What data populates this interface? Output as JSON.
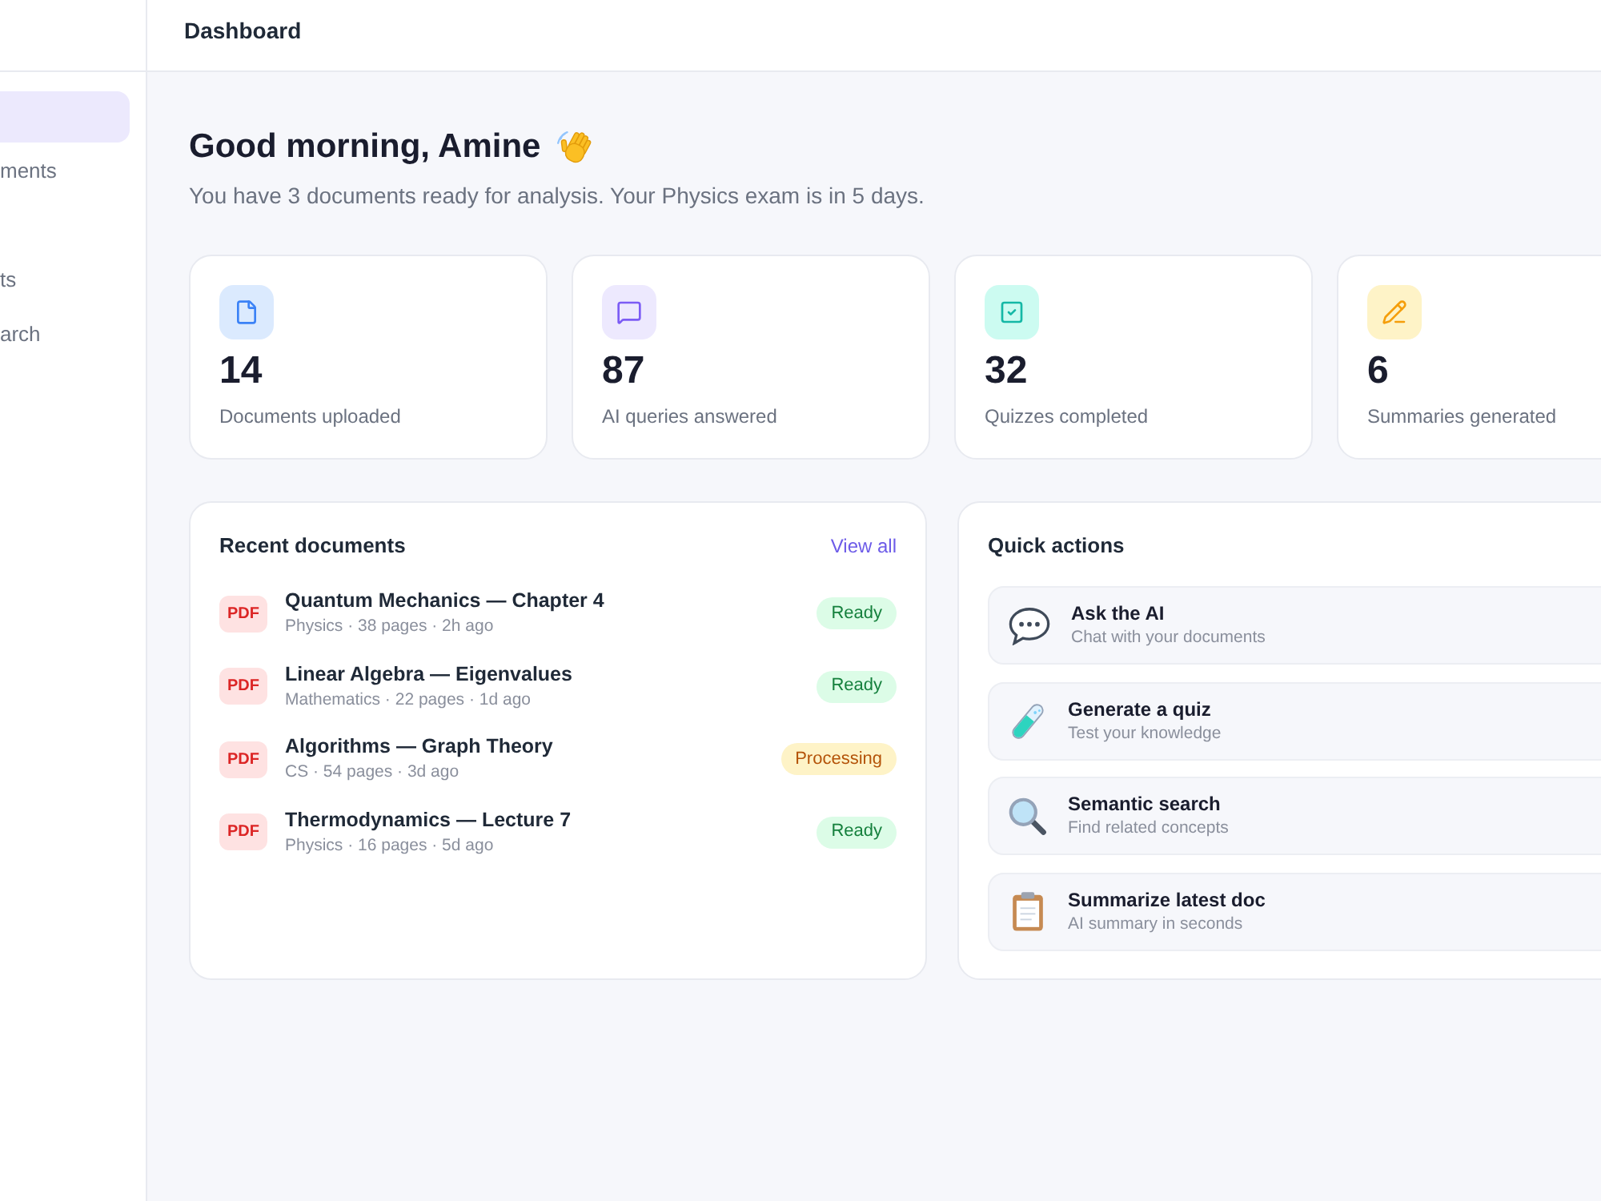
{
  "sidebar": {
    "groups": [
      [
        {
          "selected": true
        },
        {
          "label": "ments",
          "selected": false
        }
      ],
      [
        {
          "label": "ts",
          "selected": false
        },
        {
          "label": "arch",
          "selected": false
        }
      ]
    ]
  },
  "header": {
    "title": "Dashboard"
  },
  "greeting": {
    "title": "Good morning, Amine",
    "subtitle": "You have 3 documents ready for analysis. Your Physics exam is in 5 days."
  },
  "stats": [
    {
      "kind": "documents",
      "value": "14",
      "label": "Documents uploaded"
    },
    {
      "kind": "queries",
      "value": "87",
      "label": "AI queries answered"
    },
    {
      "kind": "quizzes",
      "value": "32",
      "label": "Quizzes completed"
    },
    {
      "kind": "summaries",
      "value": "6",
      "label": "Summaries generated"
    }
  ],
  "recent_documents": {
    "title": "Recent documents",
    "link": "View all",
    "items": [
      {
        "type": "PDF",
        "title": "Quantum Mechanics — Chapter 4",
        "meta": "Physics · 38 pages · 2h ago",
        "status": {
          "kind": "ready",
          "label": "Ready"
        }
      },
      {
        "type": "PDF",
        "title": "Linear Algebra — Eigenvalues",
        "meta": "Mathematics · 22 pages · 1d ago",
        "status": {
          "kind": "ready",
          "label": "Ready"
        }
      },
      {
        "type": "PDF",
        "title": "Algorithms — Graph Theory",
        "meta": "CS · 54 pages · 3d ago",
        "status": {
          "kind": "processing",
          "label": "Processing"
        }
      },
      {
        "type": "PDF",
        "title": "Thermodynamics — Lecture 7",
        "meta": "Physics · 16 pages · 5d ago",
        "status": {
          "kind": "ready",
          "label": "Ready"
        }
      }
    ]
  },
  "quick_actions": {
    "title": "Quick actions",
    "items": [
      {
        "kind": "chat",
        "title": "Ask the AI",
        "description": "Chat with your documents"
      },
      {
        "kind": "quiz",
        "title": "Generate a quiz",
        "description": "Test your knowledge"
      },
      {
        "kind": "search",
        "title": "Semantic search",
        "description": "Find related concepts"
      },
      {
        "kind": "summary",
        "title": "Summarize latest doc",
        "description": "AI summary in seconds"
      }
    ]
  }
}
